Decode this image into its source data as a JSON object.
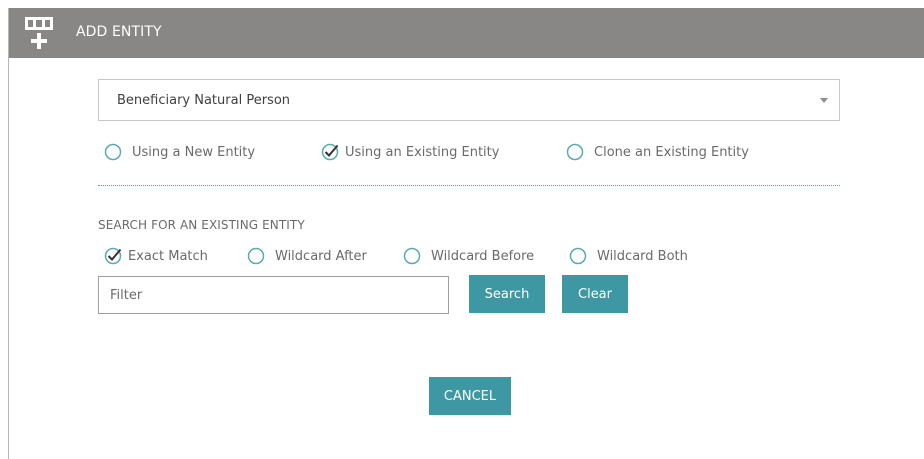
{
  "dialog": {
    "title": "ADD ENTITY",
    "icon": "add-entity-icon"
  },
  "entity_type": {
    "selected": "Beneficiary Natural Person"
  },
  "entity_mode": {
    "options": [
      {
        "label": "Using a New Entity",
        "checked": false
      },
      {
        "label": "Using an Existing Entity",
        "checked": true
      },
      {
        "label": "Clone an Existing Entity",
        "checked": false
      }
    ]
  },
  "search": {
    "heading": "SEARCH FOR AN EXISTING ENTITY",
    "match_options": [
      {
        "label": "Exact Match",
        "checked": true
      },
      {
        "label": "Wildcard After",
        "checked": false
      },
      {
        "label": "Wildcard Before",
        "checked": false
      },
      {
        "label": "Wildcard Both",
        "checked": false
      }
    ],
    "filter_value": "",
    "filter_placeholder": "Filter",
    "search_label": "Search",
    "clear_label": "Clear"
  },
  "footer": {
    "cancel_label": "CANCEL"
  },
  "colors": {
    "titlebar": "#898686",
    "accent": "#3e98a3",
    "radio": "#5aaab5"
  }
}
